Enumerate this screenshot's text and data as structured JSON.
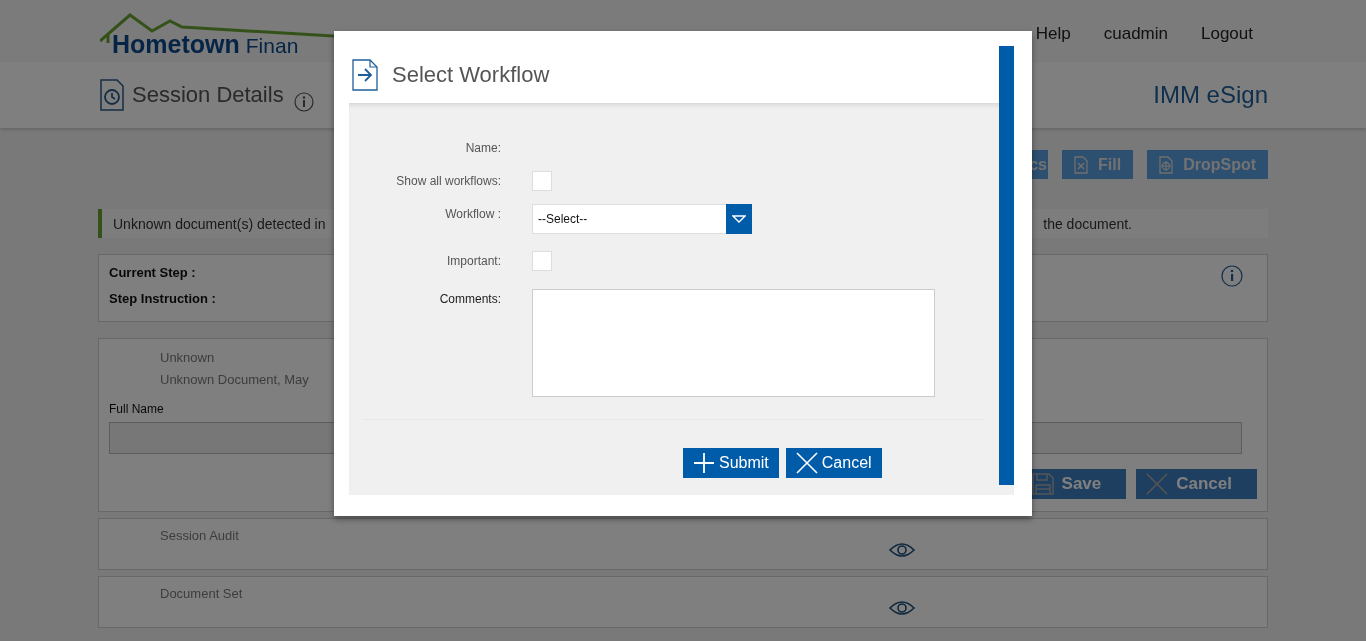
{
  "header": {
    "logo": {
      "name": "Hometown",
      "suffix": "Finan"
    },
    "nav": [
      "Help",
      "cuadmin",
      "Logout"
    ]
  },
  "subheader": {
    "title": "Session Details",
    "product": "IMM eSign"
  },
  "toolbar": [
    {
      "label": "cs"
    },
    {
      "label": "Fill"
    },
    {
      "label": "DropSpot"
    }
  ],
  "alert": {
    "text_left": "Unknown document(s) detected in",
    "text_right": "the document."
  },
  "step_panel": {
    "current_step": "Current Step :",
    "step_instruction": "Step Instruction :"
  },
  "document_panel": {
    "title": "Unknown",
    "description": "Unknown Document, May",
    "field_label": "Full Name",
    "buttons": [
      {
        "label": "Save"
      },
      {
        "label": "Cancel"
      }
    ]
  },
  "sections": [
    {
      "title": "Session Audit"
    },
    {
      "title": "Document Set"
    }
  ],
  "dialog": {
    "title": "Select Workflow",
    "fields": [
      {
        "kind": "text",
        "label": "Name:"
      },
      {
        "kind": "checkbox",
        "label": "Show all workflows:",
        "checked": false
      },
      {
        "kind": "select",
        "label": "Workflow :",
        "value": "--Select--"
      },
      {
        "kind": "checkbox",
        "label": "Important:",
        "checked": false
      },
      {
        "kind": "textarea",
        "label": "Comments:"
      }
    ],
    "buttons": [
      {
        "label": "Submit"
      },
      {
        "label": "Cancel"
      }
    ]
  }
}
